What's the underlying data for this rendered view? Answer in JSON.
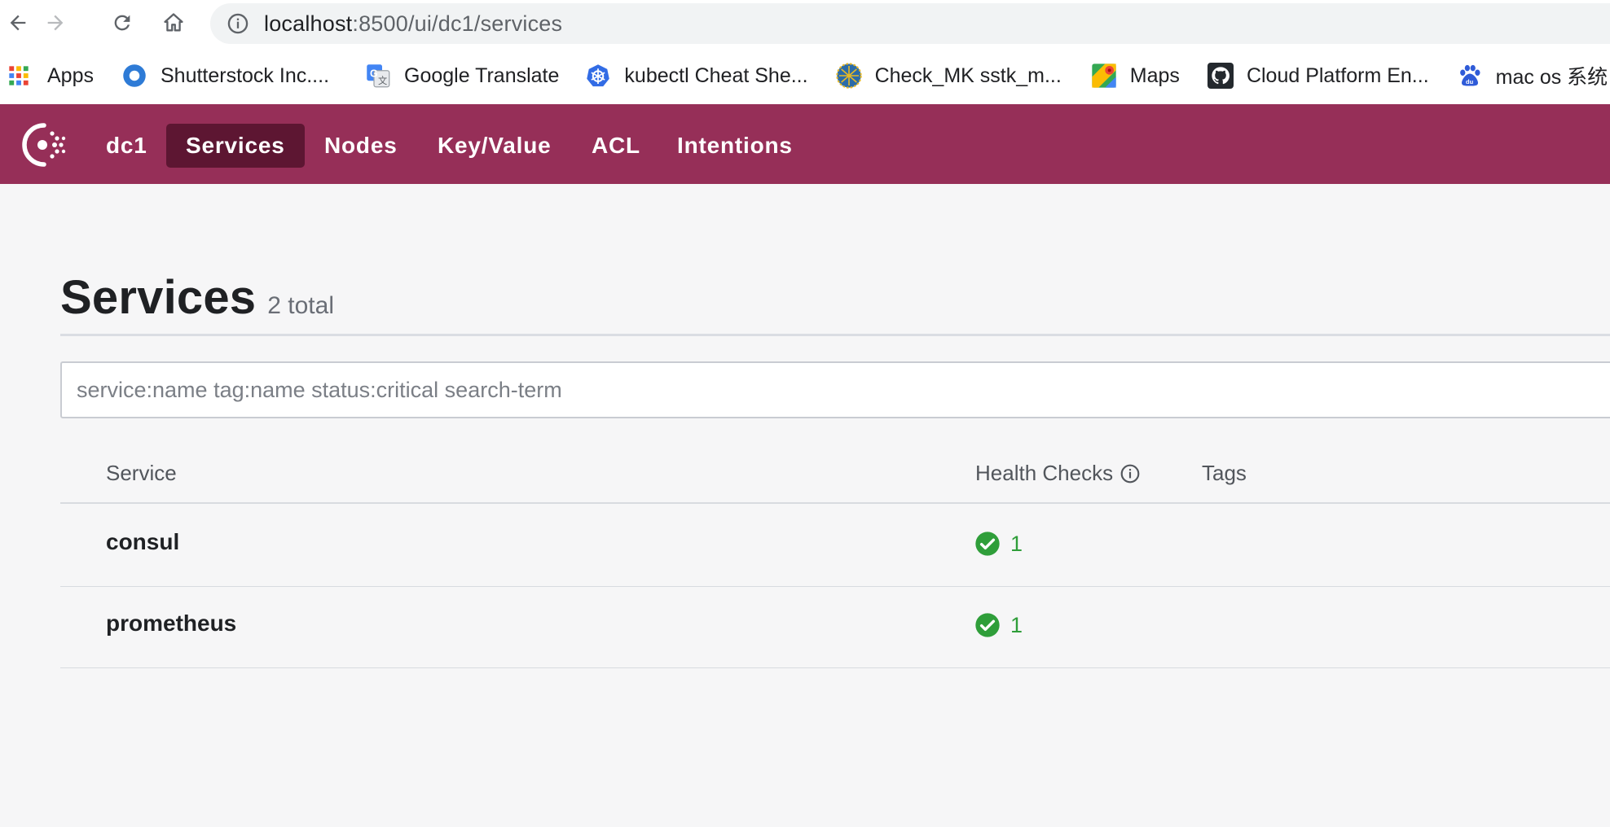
{
  "browser": {
    "url_host": "localhost",
    "url_path": ":8500/ui/dc1/services",
    "nav_icons": [
      "back-arrow-icon",
      "forward-arrow-icon",
      "reload-icon",
      "home-icon",
      "info-icon"
    ],
    "bookmarks": [
      {
        "label": "Apps",
        "icon": "apps-grid-icon"
      },
      {
        "label": "Shutterstock Inc....",
        "icon": "shutterstock-icon"
      },
      {
        "label": "Google Translate",
        "icon": "google-translate-icon"
      },
      {
        "label": "kubectl Cheat She...",
        "icon": "kubernetes-icon"
      },
      {
        "label": "Check_MK sstk_m...",
        "icon": "checkmk-icon"
      },
      {
        "label": "Maps",
        "icon": "maps-icon"
      },
      {
        "label": "Cloud Platform En...",
        "icon": "github-icon"
      },
      {
        "label": "mac os 系统",
        "icon": "baidu-icon"
      }
    ]
  },
  "header": {
    "brand_color": "#962f58",
    "active_color": "#5d1632",
    "logo_icon": "consul-logo-icon",
    "datacenter": "dc1",
    "nav": [
      {
        "label": "Services",
        "active": true
      },
      {
        "label": "Nodes",
        "active": false
      },
      {
        "label": "Key/Value",
        "active": false
      },
      {
        "label": "ACL",
        "active": false
      },
      {
        "label": "Intentions",
        "active": false
      }
    ]
  },
  "main": {
    "title": "Services",
    "count": "2 total",
    "search_placeholder": "service:name tag:name status:critical search-term",
    "columns": {
      "service": "Service",
      "health_checks": "Health Checks",
      "tags": "Tags"
    },
    "rows": [
      {
        "name": "consul",
        "passing": "1",
        "status": "passing",
        "status_color": "#2f9e3a"
      },
      {
        "name": "prometheus",
        "passing": "1",
        "status": "passing",
        "status_color": "#2f9e3a"
      }
    ]
  }
}
